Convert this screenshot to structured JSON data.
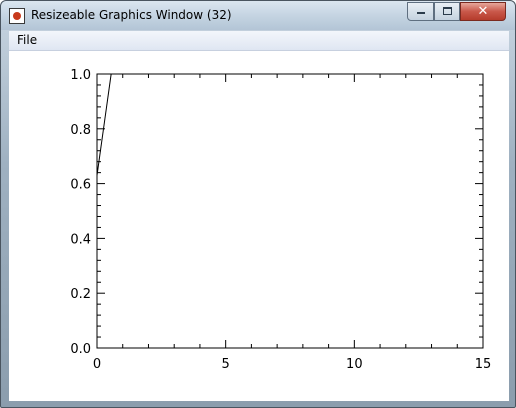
{
  "window": {
    "title": "Resizeable Graphics Window (32)",
    "icon": "idl-app-icon",
    "controls": {
      "minimize": "minimize-icon",
      "maximize": "maximize-icon",
      "close": "close-icon",
      "close_glyph": "✕"
    }
  },
  "menu": {
    "items": [
      {
        "label": "File"
      }
    ]
  },
  "colors": {
    "plot_background": "#ffffff",
    "axes": "#000000",
    "line": "#000000"
  },
  "chart_data": {
    "type": "line",
    "title": "",
    "xlabel": "",
    "ylabel": "",
    "xlim": [
      0,
      15
    ],
    "ylim": [
      0.0,
      1.0
    ],
    "xticks": [
      0,
      5,
      10,
      15
    ],
    "xtick_labels": [
      "0",
      "5",
      "10",
      "15"
    ],
    "yticks": [
      0.0,
      0.2,
      0.4,
      0.6,
      0.8,
      1.0
    ],
    "ytick_labels": [
      "0.0",
      "0.2",
      "0.4",
      "0.6",
      "0.8",
      "1.0"
    ],
    "x_minor_ticks_per_major": 5,
    "y_minor_ticks_per_major": 5,
    "grid": false,
    "mirror_ticks": true,
    "series": [
      {
        "x": [
          0.0,
          0.55
        ],
        "y": [
          0.63,
          1.0
        ]
      }
    ]
  }
}
